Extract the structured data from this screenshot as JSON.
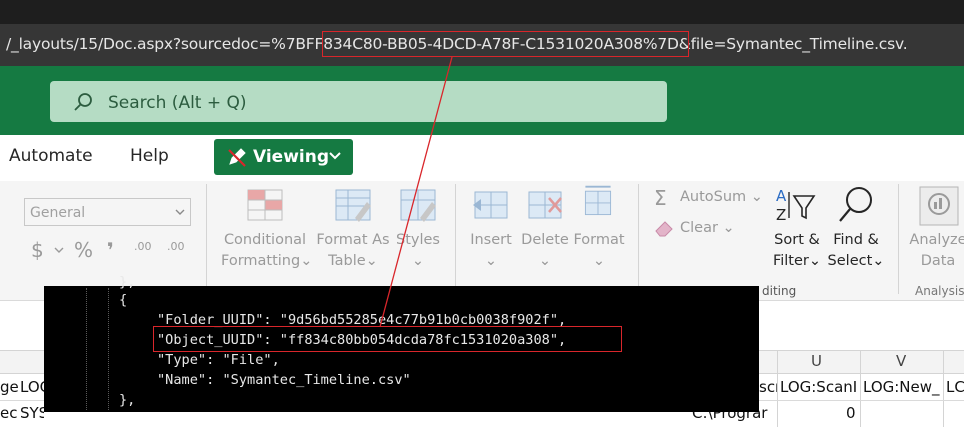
{
  "browser": {
    "url": "/_layouts/15/Doc.aspx?sourcedoc=%7BFF834C80-BB05-4DCD-A78F-C1531020A308%7D&file=Symantec_Timeline.csv."
  },
  "header": {
    "search_placeholder": "Search (Alt + Q)"
  },
  "tabs": {
    "automate": "Automate",
    "help": "Help",
    "viewing": "Viewing"
  },
  "ribbon": {
    "number_format": "General",
    "currency_symbol": "$",
    "percent_symbol": "%",
    "comma_symbol": "❜",
    "increase_decimal": ".00",
    "decrease_decimal": ".00",
    "conditional_formatting": [
      "Conditional",
      "Formatting"
    ],
    "format_as_table": [
      "Format As",
      "Table"
    ],
    "styles": "Styles",
    "insert": "Insert",
    "delete": "Delete",
    "format": "Format",
    "autosum": "AutoSum",
    "clear": "Clear",
    "sort_filter": [
      "Sort &",
      "Filter"
    ],
    "find_select": [
      "Find &",
      "Select"
    ],
    "analyze_data": [
      "Analyze",
      "Data"
    ],
    "group_editing": "diting",
    "group_analysis": "Analysis"
  },
  "sheet": {
    "col_u": "U",
    "col_v": "V",
    "cell_left_a": "ge",
    "cell_left_b": "LOG",
    "cell_left_c": "ec",
    "cell_left_d": "SYSTEM",
    "cell_mid_a": "scr",
    "cell_mid_b": "C:\\Prograr",
    "cell_u": "LOG:ScanI",
    "cell_v": "LOG:New_",
    "cell_w": "LC",
    "cell_u_value": "0"
  },
  "overlay": {
    "lines": [
      "},",
      "{",
      "\"Folder_UUID\": \"9d56bd55285e4c77b91b0cb0038f902f\",",
      "\"Object_UUID\": \"ff834c80bb054dcda78fc1531020a308\",",
      "\"Type\": \"File\",",
      "\"Name\": \"Symantec_Timeline.csv\"",
      "},"
    ]
  },
  "colors": {
    "excel_green": "#157a42",
    "highlight_red": "#d9262b",
    "search_bg": "#b5dcc4",
    "url_bar": "#363636"
  },
  "icons": [
    "search-icon",
    "pencil-icon",
    "chevron-down-icon",
    "sigma-icon",
    "eraser-icon",
    "sort-filter-icon",
    "find-icon",
    "analyze-icon"
  ]
}
